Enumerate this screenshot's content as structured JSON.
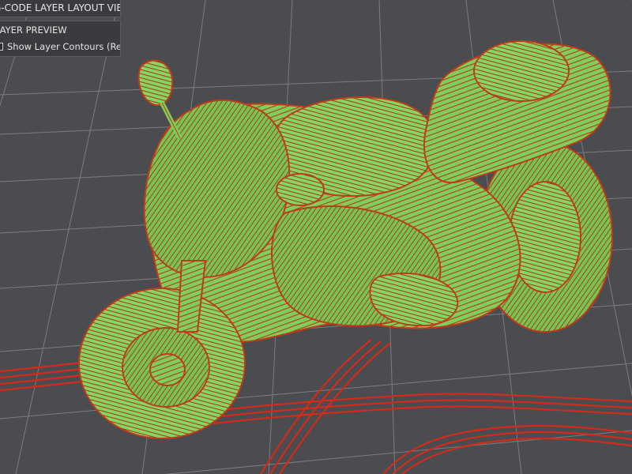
{
  "viewer": {
    "title": "G-CODE LAYER LAYOUT VIEW",
    "preview_heading": "LAYER PREVIEW",
    "contours_label": "Show Layer Contours (Red)",
    "contours_checked": false
  },
  "colors": {
    "background": "#4b4c4f",
    "grid_line": "#9a9b9e",
    "model_fill": "#7ecf5a",
    "contour_red": "#d42a1a",
    "panel_bg": "#3a3b3e"
  }
}
